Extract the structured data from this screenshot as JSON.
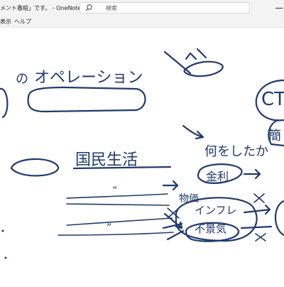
{
  "window": {
    "title": "メント番組」です。 - OneNote",
    "search_placeholder": "検索"
  },
  "menu": {
    "items": [
      "表示",
      "ヘルプ"
    ]
  },
  "ink": {
    "color": "#1f3a6e",
    "label_no": "の",
    "label_operation": "オペレーション",
    "label_citizen_life": "国民生活",
    "label_what_to_do": "何をしたか",
    "label_interest_rate": "金利",
    "label_prices": "物価",
    "label_inflation": "インフレ",
    "label_recession": "不景気",
    "label_ct": "CT",
    "label_quotes_1": "”",
    "label_quotes_2": "”",
    "label_kan": "簡"
  }
}
